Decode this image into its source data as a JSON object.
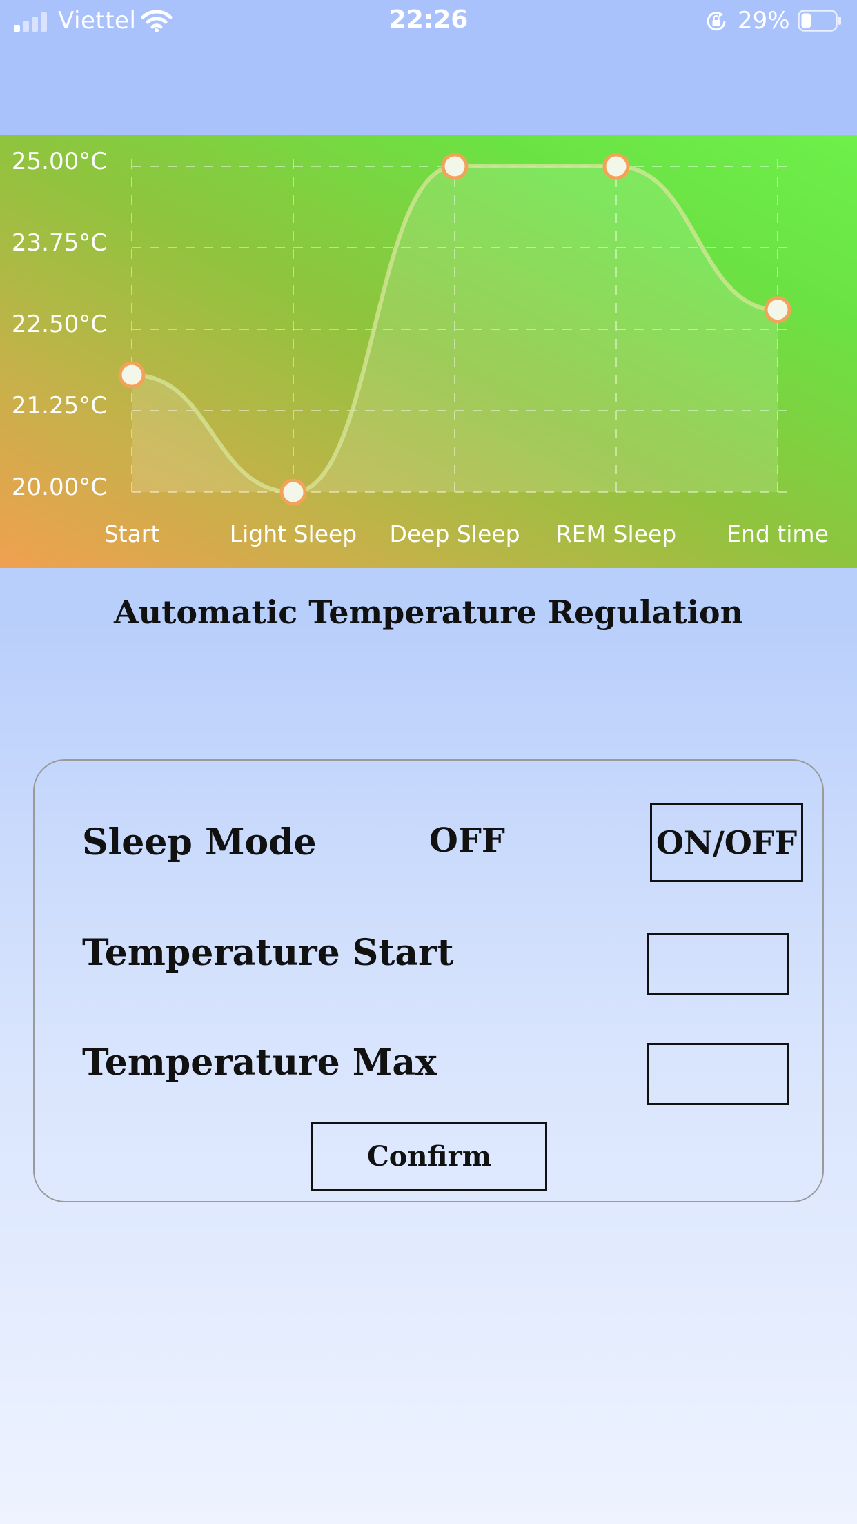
{
  "status_bar": {
    "carrier": "Viettel",
    "time": "22:26",
    "battery_percent": "29%",
    "battery_level": 0.29,
    "icons": [
      "signal-icon",
      "wifi-icon",
      "orientation-lock-icon",
      "battery-icon"
    ]
  },
  "chart_data": {
    "type": "line",
    "categories": [
      "Start",
      "Light Sleep",
      "Deep Sleep",
      "REM Sleep",
      "End time"
    ],
    "values": [
      21.8,
      20.0,
      25.0,
      25.0,
      22.8
    ],
    "ylim": [
      20.0,
      25.0
    ],
    "ytick_labels": [
      "25.00°C",
      "23.75°C",
      "22.50°C",
      "21.25°C",
      "20.00°C"
    ],
    "yticks": [
      25.0,
      23.75,
      22.5,
      21.25,
      20.0
    ],
    "grid": true,
    "title": "",
    "xlabel": "",
    "ylabel": "",
    "colors": {
      "line": "#d8e69a",
      "point_fill": "#f2f7ea",
      "point_stroke": "#f3a25a",
      "label": "#ffffff"
    }
  },
  "main": {
    "title": "Automatic Temperature Regulation"
  },
  "form": {
    "sleep_mode_label": "Sleep Mode",
    "sleep_mode_status": "OFF",
    "toggle_label": "ON/OFF",
    "temp_start_label": "Temperature Start",
    "temp_start_value": "",
    "temp_max_label": "Temperature Max",
    "temp_max_value": "",
    "confirm_label": "Confirm"
  }
}
